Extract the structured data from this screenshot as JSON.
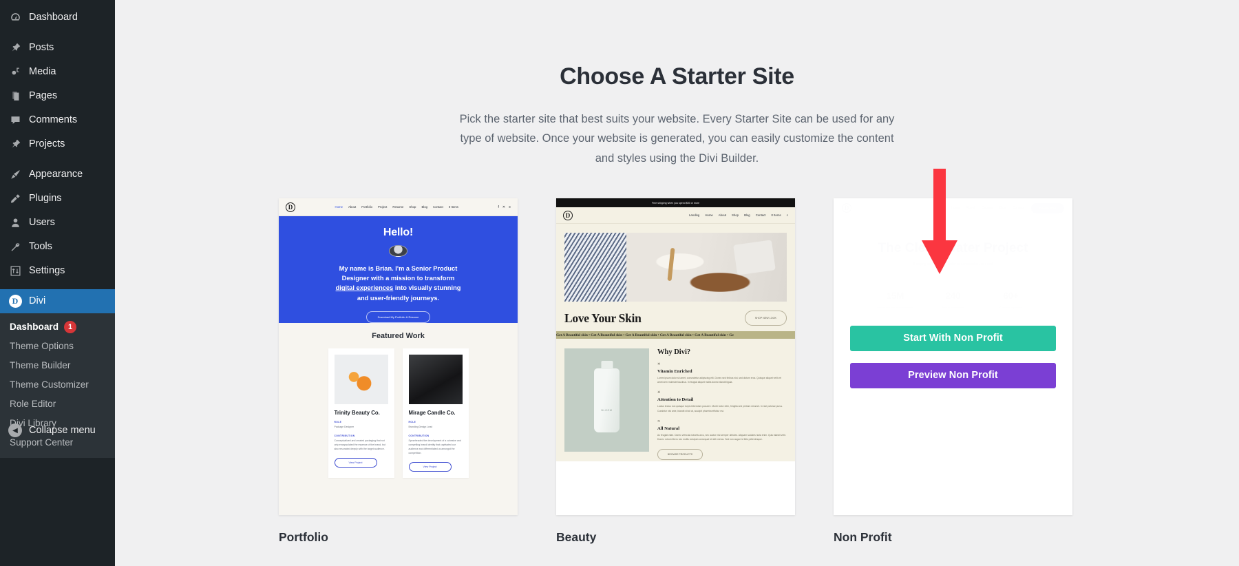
{
  "sidebar": {
    "items": [
      {
        "label": "Dashboard",
        "icon": "dashboard-icon"
      },
      {
        "label": "Posts",
        "icon": "pin-icon"
      },
      {
        "label": "Media",
        "icon": "media-icon"
      },
      {
        "label": "Pages",
        "icon": "pages-icon"
      },
      {
        "label": "Comments",
        "icon": "comment-icon"
      },
      {
        "label": "Projects",
        "icon": "pin-icon"
      },
      {
        "label": "Appearance",
        "icon": "brush-icon"
      },
      {
        "label": "Plugins",
        "icon": "plug-icon"
      },
      {
        "label": "Users",
        "icon": "user-icon"
      },
      {
        "label": "Tools",
        "icon": "wrench-icon"
      },
      {
        "label": "Settings",
        "icon": "sliders-icon"
      }
    ],
    "divi": {
      "label": "Divi",
      "icon": "divi-logo-icon",
      "mark": "D"
    },
    "submenu": [
      {
        "label": "Dashboard",
        "badge": "1",
        "current": true
      },
      {
        "label": "Theme Options",
        "badge": "",
        "current": false
      },
      {
        "label": "Theme Builder",
        "badge": "",
        "current": false
      },
      {
        "label": "Theme Customizer",
        "badge": "",
        "current": false
      },
      {
        "label": "Role Editor",
        "badge": "",
        "current": false
      },
      {
        "label": "Divi Library",
        "badge": "",
        "current": false
      },
      {
        "label": "Support Center",
        "badge": "",
        "current": false
      }
    ],
    "collapse": {
      "label": "Collapse menu",
      "icon": "chevron-left-icon"
    },
    "colors": {
      "background": "#1d2327",
      "submenu_background": "#2c3338",
      "active": "#2271b1",
      "badge": "#d63638"
    }
  },
  "main": {
    "title": "Choose A Starter Site",
    "description": "Pick the starter site that best suits your website. Every Starter Site can be used for any type of website. Once your website is generated, you can easily customize the content and styles using the Divi Builder."
  },
  "cards": [
    {
      "label": "Portfolio",
      "nav_links": [
        "Home",
        "About",
        "Portfolio",
        "Project",
        "Resume",
        "Shop",
        "Blog",
        "Contact",
        "0 Items"
      ],
      "hero_heading": "Hello!",
      "hero_copy_line1": "My name is Brian. I'm a Senior Product",
      "hero_copy_line2": "Designer with a mission to transform",
      "hero_copy_link": "digital experiences",
      "hero_copy_line3": " into visually stunning",
      "hero_copy_line4": "and user-friendly journeys.",
      "hero_button": "Download My Portfolio & Resume",
      "section_title": "Featured Work",
      "works": [
        {
          "name": "Trinity Beauty Co.",
          "role_label": "ROLE",
          "role": "Package Designer",
          "contribution_label": "CONTRIBUTION",
          "contribution": "Conceptualized and created packaging that not only encapsulated the essence of the brand, but also resonated deeply with the target audience.",
          "button": "View Project"
        },
        {
          "name": "Mirage Candle Co.",
          "role_label": "ROLE",
          "role": "Branding Design Lead",
          "contribution_label": "CONTRIBUTION",
          "contribution": "Spearheaded the development of a cohesive and compelling brand identity that captivated our audience and differentiated us amongst the competition.",
          "button": "View Project"
        }
      ]
    },
    {
      "label": "Beauty",
      "topbar": "Free shipping when you spend $50 or more",
      "nav_links": [
        "Landing",
        "Home",
        "About",
        "Shop",
        "Blog",
        "Contact",
        "0 Items"
      ],
      "hero_title": "Love Your Skin",
      "hero_button": "SHOP NEW LOOK",
      "marquee": "Get A Beautiful skin • Get A Beautiful skin • Get A Beautiful skin • Get A Beautiful skin • Get A Beautiful skin • Ge",
      "bottle_label": "BLOOM",
      "section_title": "Why Divi?",
      "features": [
        {
          "heading": "Vitamin Enriched",
          "body": "Lorem ipsum dolor sit amet, consectetur adipiscing elit. Donec sed finibus nisi, sed dictum eros. Quisque aliquet velit vel amet sem molestie faucibus. In feugiat aliquet mollis donec blandit ligula."
        },
        {
          "heading": "Attention to Detail",
          "body": "Luctus lectus non quisque turpis bibendum posuere. Morbi tortor nibh, fringilla sed pretium sit amet. In nisl pulvinar purus. Curabitur nisi ante, blandit sit sit at, suscipit pharetra efficitur est."
        },
        {
          "heading": "All Natural",
          "body": "Ac feugiat vitae. Donec vehicula lobortis arcu, nec auctor nisl semper ultricies. Aliquam sodales nulla enim. Quis blandit velit. Donec rutrum libero nec mollis volutpat consequat id nibh metus. Sed non augue id felis pellentesque."
        }
      ],
      "feature_button": "BROWSE PRODUCTS"
    },
    {
      "label": "Non Profit",
      "nav_links": [
        "Home",
        "About",
        "Causes",
        "Blog",
        "Contact"
      ],
      "nav_cta": "Donate Now",
      "hero_title": "The Clean Water Project",
      "hero_sub": "Bringing safe drinking water to communities in need",
      "stats": [
        {
          "number": "15M",
          "label": "People reached with clean water"
        },
        {
          "number": "240",
          "label": "Wells built worldwide"
        },
        {
          "number": "60+",
          "label": "Countries supported"
        }
      ],
      "buttons": {
        "start": "Start With Non Profit",
        "preview": "Preview Non Profit",
        "start_color": "#29c3a2",
        "preview_color": "#7b3fd4"
      }
    }
  ],
  "annotation": {
    "arrow": "red-down-arrow",
    "color": "#fb3640"
  }
}
